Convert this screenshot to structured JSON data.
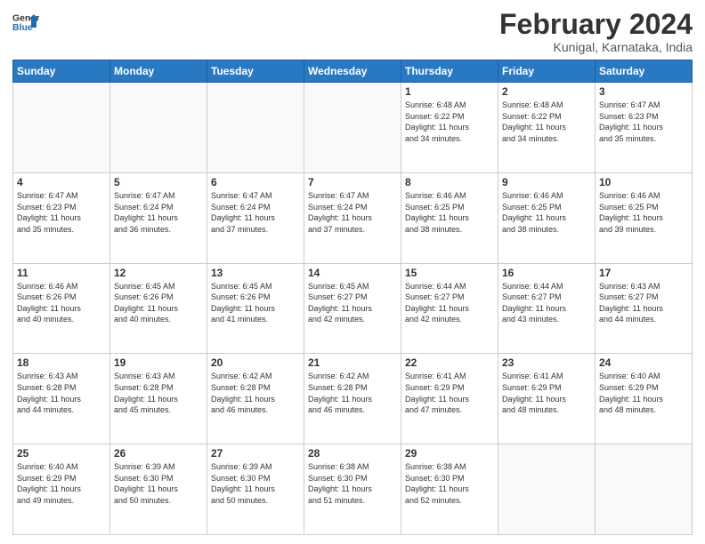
{
  "header": {
    "logo_line1": "General",
    "logo_line2": "Blue",
    "title": "February 2024",
    "subtitle": "Kunigal, Karnataka, India"
  },
  "calendar": {
    "weekdays": [
      "Sunday",
      "Monday",
      "Tuesday",
      "Wednesday",
      "Thursday",
      "Friday",
      "Saturday"
    ],
    "weeks": [
      [
        {
          "day": "",
          "info": ""
        },
        {
          "day": "",
          "info": ""
        },
        {
          "day": "",
          "info": ""
        },
        {
          "day": "",
          "info": ""
        },
        {
          "day": "1",
          "info": "Sunrise: 6:48 AM\nSunset: 6:22 PM\nDaylight: 11 hours\nand 34 minutes."
        },
        {
          "day": "2",
          "info": "Sunrise: 6:48 AM\nSunset: 6:22 PM\nDaylight: 11 hours\nand 34 minutes."
        },
        {
          "day": "3",
          "info": "Sunrise: 6:47 AM\nSunset: 6:23 PM\nDaylight: 11 hours\nand 35 minutes."
        }
      ],
      [
        {
          "day": "4",
          "info": "Sunrise: 6:47 AM\nSunset: 6:23 PM\nDaylight: 11 hours\nand 35 minutes."
        },
        {
          "day": "5",
          "info": "Sunrise: 6:47 AM\nSunset: 6:24 PM\nDaylight: 11 hours\nand 36 minutes."
        },
        {
          "day": "6",
          "info": "Sunrise: 6:47 AM\nSunset: 6:24 PM\nDaylight: 11 hours\nand 37 minutes."
        },
        {
          "day": "7",
          "info": "Sunrise: 6:47 AM\nSunset: 6:24 PM\nDaylight: 11 hours\nand 37 minutes."
        },
        {
          "day": "8",
          "info": "Sunrise: 6:46 AM\nSunset: 6:25 PM\nDaylight: 11 hours\nand 38 minutes."
        },
        {
          "day": "9",
          "info": "Sunrise: 6:46 AM\nSunset: 6:25 PM\nDaylight: 11 hours\nand 38 minutes."
        },
        {
          "day": "10",
          "info": "Sunrise: 6:46 AM\nSunset: 6:25 PM\nDaylight: 11 hours\nand 39 minutes."
        }
      ],
      [
        {
          "day": "11",
          "info": "Sunrise: 6:46 AM\nSunset: 6:26 PM\nDaylight: 11 hours\nand 40 minutes."
        },
        {
          "day": "12",
          "info": "Sunrise: 6:45 AM\nSunset: 6:26 PM\nDaylight: 11 hours\nand 40 minutes."
        },
        {
          "day": "13",
          "info": "Sunrise: 6:45 AM\nSunset: 6:26 PM\nDaylight: 11 hours\nand 41 minutes."
        },
        {
          "day": "14",
          "info": "Sunrise: 6:45 AM\nSunset: 6:27 PM\nDaylight: 11 hours\nand 42 minutes."
        },
        {
          "day": "15",
          "info": "Sunrise: 6:44 AM\nSunset: 6:27 PM\nDaylight: 11 hours\nand 42 minutes."
        },
        {
          "day": "16",
          "info": "Sunrise: 6:44 AM\nSunset: 6:27 PM\nDaylight: 11 hours\nand 43 minutes."
        },
        {
          "day": "17",
          "info": "Sunrise: 6:43 AM\nSunset: 6:27 PM\nDaylight: 11 hours\nand 44 minutes."
        }
      ],
      [
        {
          "day": "18",
          "info": "Sunrise: 6:43 AM\nSunset: 6:28 PM\nDaylight: 11 hours\nand 44 minutes."
        },
        {
          "day": "19",
          "info": "Sunrise: 6:43 AM\nSunset: 6:28 PM\nDaylight: 11 hours\nand 45 minutes."
        },
        {
          "day": "20",
          "info": "Sunrise: 6:42 AM\nSunset: 6:28 PM\nDaylight: 11 hours\nand 46 minutes."
        },
        {
          "day": "21",
          "info": "Sunrise: 6:42 AM\nSunset: 6:28 PM\nDaylight: 11 hours\nand 46 minutes."
        },
        {
          "day": "22",
          "info": "Sunrise: 6:41 AM\nSunset: 6:29 PM\nDaylight: 11 hours\nand 47 minutes."
        },
        {
          "day": "23",
          "info": "Sunrise: 6:41 AM\nSunset: 6:29 PM\nDaylight: 11 hours\nand 48 minutes."
        },
        {
          "day": "24",
          "info": "Sunrise: 6:40 AM\nSunset: 6:29 PM\nDaylight: 11 hours\nand 48 minutes."
        }
      ],
      [
        {
          "day": "25",
          "info": "Sunrise: 6:40 AM\nSunset: 6:29 PM\nDaylight: 11 hours\nand 49 minutes."
        },
        {
          "day": "26",
          "info": "Sunrise: 6:39 AM\nSunset: 6:30 PM\nDaylight: 11 hours\nand 50 minutes."
        },
        {
          "day": "27",
          "info": "Sunrise: 6:39 AM\nSunset: 6:30 PM\nDaylight: 11 hours\nand 50 minutes."
        },
        {
          "day": "28",
          "info": "Sunrise: 6:38 AM\nSunset: 6:30 PM\nDaylight: 11 hours\nand 51 minutes."
        },
        {
          "day": "29",
          "info": "Sunrise: 6:38 AM\nSunset: 6:30 PM\nDaylight: 11 hours\nand 52 minutes."
        },
        {
          "day": "",
          "info": ""
        },
        {
          "day": "",
          "info": ""
        }
      ]
    ]
  }
}
